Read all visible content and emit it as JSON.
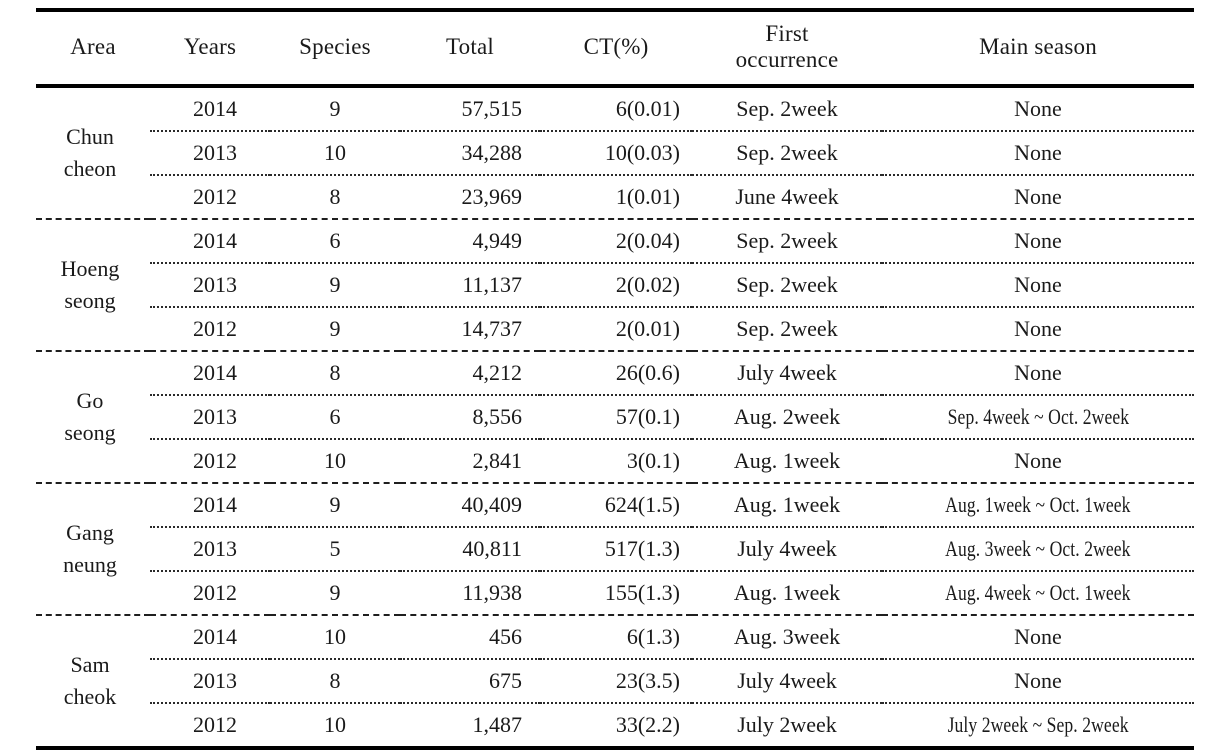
{
  "table": {
    "columns": [
      {
        "key": "area",
        "label": "Area"
      },
      {
        "key": "years",
        "label": "Years"
      },
      {
        "key": "species",
        "label": "Species"
      },
      {
        "key": "total",
        "label": "Total"
      },
      {
        "key": "ct",
        "label": "CT(%)"
      },
      {
        "key": "first",
        "label_line1": "First",
        "label_line2": "occurrence"
      },
      {
        "key": "season",
        "label": "Main season"
      }
    ],
    "header": {
      "area": "Area",
      "years": "Years",
      "species": "Species",
      "total": "Total",
      "ct": "CT(%)",
      "first_line1": "First",
      "first_line2": "occurrence",
      "season": "Main season"
    },
    "groups": [
      {
        "area_line1": "Chun",
        "area_line2": "cheon",
        "rows": [
          {
            "years": "2014",
            "species": "9",
            "total": "57,515",
            "ct": "6(0.01)",
            "first": "Sep. 2week",
            "season": "None"
          },
          {
            "years": "2013",
            "species": "10",
            "total": "34,288",
            "ct": "10(0.03)",
            "first": "Sep. 2week",
            "season": "None"
          },
          {
            "years": "2012",
            "species": "8",
            "total": "23,969",
            "ct": "1(0.01)",
            "first": "June 4week",
            "season": "None"
          }
        ]
      },
      {
        "area_line1": "Hoeng",
        "area_line2": "seong",
        "rows": [
          {
            "years": "2014",
            "species": "6",
            "total": "4,949",
            "ct": "2(0.04)",
            "first": "Sep. 2week",
            "season": "None"
          },
          {
            "years": "2013",
            "species": "9",
            "total": "11,137",
            "ct": "2(0.02)",
            "first": "Sep. 2week",
            "season": "None"
          },
          {
            "years": "2012",
            "species": "9",
            "total": "14,737",
            "ct": "2(0.01)",
            "first": "Sep. 2week",
            "season": "None"
          }
        ]
      },
      {
        "area_line1": "Go",
        "area_line2": "seong",
        "rows": [
          {
            "years": "2014",
            "species": "8",
            "total": "4,212",
            "ct": "26(0.6)",
            "first": "July 4week",
            "season": "None"
          },
          {
            "years": "2013",
            "species": "6",
            "total": "8,556",
            "ct": "57(0.1)",
            "first": "Aug. 2week",
            "season": "Sep. 4week ~ Oct. 2week"
          },
          {
            "years": "2012",
            "species": "10",
            "total": "2,841",
            "ct": "3(0.1)",
            "first": "Aug. 1week",
            "season": "None"
          }
        ]
      },
      {
        "area_line1": "Gang",
        "area_line2": "neung",
        "rows": [
          {
            "years": "2014",
            "species": "9",
            "total": "40,409",
            "ct": "624(1.5)",
            "first": "Aug. 1week",
            "season": "Aug. 1week ~ Oct. 1week"
          },
          {
            "years": "2013",
            "species": "5",
            "total": "40,811",
            "ct": "517(1.3)",
            "first": "July 4week",
            "season": "Aug. 3week ~ Oct. 2week"
          },
          {
            "years": "2012",
            "species": "9",
            "total": "11,938",
            "ct": "155(1.3)",
            "first": "Aug. 1week",
            "season": "Aug. 4week ~ Oct. 1week"
          }
        ]
      },
      {
        "area_line1": "Sam",
        "area_line2": "cheok",
        "rows": [
          {
            "years": "2014",
            "species": "10",
            "total": "456",
            "ct": "6(1.3)",
            "first": "Aug. 3week",
            "season": "None"
          },
          {
            "years": "2013",
            "species": "8",
            "total": "675",
            "ct": "23(3.5)",
            "first": "July 4week",
            "season": "None"
          },
          {
            "years": "2012",
            "species": "10",
            "total": "1,487",
            "ct": "33(2.2)",
            "first": "July 2week",
            "season": "July 2week ~ Sep. 2week"
          }
        ]
      }
    ]
  }
}
